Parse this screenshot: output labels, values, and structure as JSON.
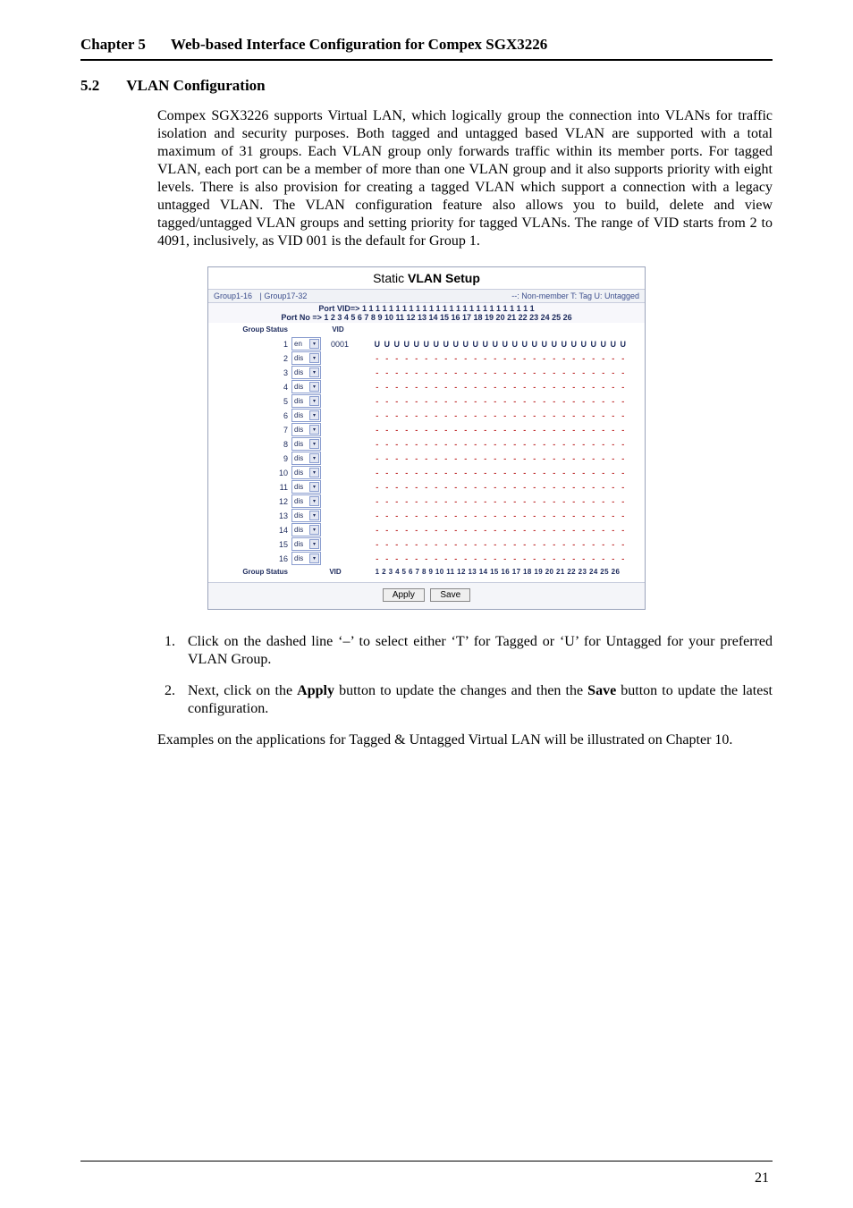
{
  "header": {
    "chapter": "Chapter 5",
    "title": "Web-based Interface Configuration for Compex SGX3226"
  },
  "section": {
    "number": "5.2",
    "title": "VLAN Configuration"
  },
  "intro": "Compex SGX3226 supports Virtual LAN, which logically group the connection into VLANs for traffic isolation and security purposes. Both tagged and untagged based VLAN are supported with a total maximum of 31 groups. Each VLAN group only forwards traffic within its member ports. For tagged VLAN, each port can be a member of more than one VLAN group and it also supports priority with eight levels. There is also provision for creating a tagged VLAN which support a connection with a legacy untagged VLAN. The VLAN configuration feature also allows you to build, delete and view tagged/untagged VLAN groups and setting priority for tagged VLANs. The range of VID starts from 2 to 4091, inclusively, as VID 001 is the default for Group 1.",
  "panel": {
    "title_static": "Static",
    "title_rest": " VLAN Setup",
    "tabs_left1": "Group1-16",
    "tabs_left2": "Group17-32",
    "legend": "--: Non-member  T: Tag  U: Untagged",
    "port_vid_label": "Port VID=>",
    "port_vid_line": "1 1 1 1 1 1 1 1 1 1 1 1 1 1 1 1 1 1 1 1 1   1 1 1 1 1",
    "port_no_label": "Port No =>",
    "port_no_line": "1 2 3 4 5 6 7 8 9 10 11 12 13 14 15 16 17 18 19 20 21 22 23 24 25 26",
    "col_group": "Group",
    "col_status": "Status",
    "col_vid": "VID",
    "rows": [
      {
        "group": "1",
        "status": "en",
        "vid": "0001",
        "ports": "U"
      },
      {
        "group": "2",
        "status": "dis",
        "vid": "",
        "ports": "-"
      },
      {
        "group": "3",
        "status": "dis",
        "vid": "",
        "ports": "-"
      },
      {
        "group": "4",
        "status": "dis",
        "vid": "",
        "ports": "-"
      },
      {
        "group": "5",
        "status": "dis",
        "vid": "",
        "ports": "-"
      },
      {
        "group": "6",
        "status": "dis",
        "vid": "",
        "ports": "-"
      },
      {
        "group": "7",
        "status": "dis",
        "vid": "",
        "ports": "-"
      },
      {
        "group": "8",
        "status": "dis",
        "vid": "",
        "ports": "-"
      },
      {
        "group": "9",
        "status": "dis",
        "vid": "",
        "ports": "-"
      },
      {
        "group": "10",
        "status": "dis",
        "vid": "",
        "ports": "-"
      },
      {
        "group": "11",
        "status": "dis",
        "vid": "",
        "ports": "-"
      },
      {
        "group": "12",
        "status": "dis",
        "vid": "",
        "ports": "-"
      },
      {
        "group": "13",
        "status": "dis",
        "vid": "",
        "ports": "-"
      },
      {
        "group": "14",
        "status": "dis",
        "vid": "",
        "ports": "-"
      },
      {
        "group": "15",
        "status": "dis",
        "vid": "",
        "ports": "-"
      },
      {
        "group": "16",
        "status": "dis",
        "vid": "",
        "ports": "-"
      }
    ],
    "footer_nums": "1 2 3 4 5 6 7 8 9 10 11 12 13 14 15 16 17 18 19 20 21 22 23 24 25 26",
    "apply": "Apply",
    "save": "Save"
  },
  "steps": {
    "s1": "Click on the dashed line ‘–’ to select either ‘T’ for Tagged or ‘U’ for Untagged for your preferred VLAN Group.",
    "s2a": "Next, click on the ",
    "s2b": "Apply",
    "s2c": " button to update the changes and then the ",
    "s2d": "Save",
    "s2e": " button to update the latest configuration."
  },
  "closing": "Examples on the applications for Tagged & Untagged Virtual LAN will be illustrated on Chapter 10.",
  "page_number": "21"
}
